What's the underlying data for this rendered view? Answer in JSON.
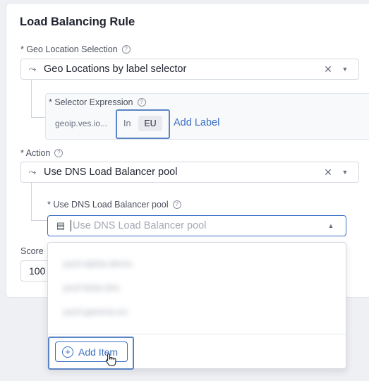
{
  "form": {
    "title": "Load Balancing Rule",
    "geo_location": {
      "label": "* Geo Location Selection",
      "value": "Geo Locations by label selector"
    },
    "selector_expression": {
      "label": "* Selector Expression",
      "key": "geoip.ves.io...",
      "operator": "In",
      "value": "EU",
      "add_label": "Add Label"
    },
    "action": {
      "label": "* Action",
      "value": "Use DNS Load Balancer pool"
    },
    "dns_pool": {
      "label": "* Use DNS Load Balancer pool",
      "placeholder": "Use DNS Load Balancer pool",
      "options": [
        "pool-alpha-demo",
        "pool-beta-dns",
        "pool-gamma-eu"
      ],
      "add_item": "Add Item"
    },
    "score": {
      "label": "Score",
      "value": "100"
    }
  },
  "icons": {
    "help": "question-circle-icon",
    "selection": "branch-icon",
    "pool": "list-card-icon",
    "clear": "close-icon",
    "chevron_down": "chevron-down-icon",
    "chevron_up": "chevron-up-icon",
    "add": "plus-circle-icon",
    "cursor": "hand-pointer-icon"
  },
  "colors": {
    "accent": "#3a6fc4",
    "highlight": "#5b84c4"
  }
}
